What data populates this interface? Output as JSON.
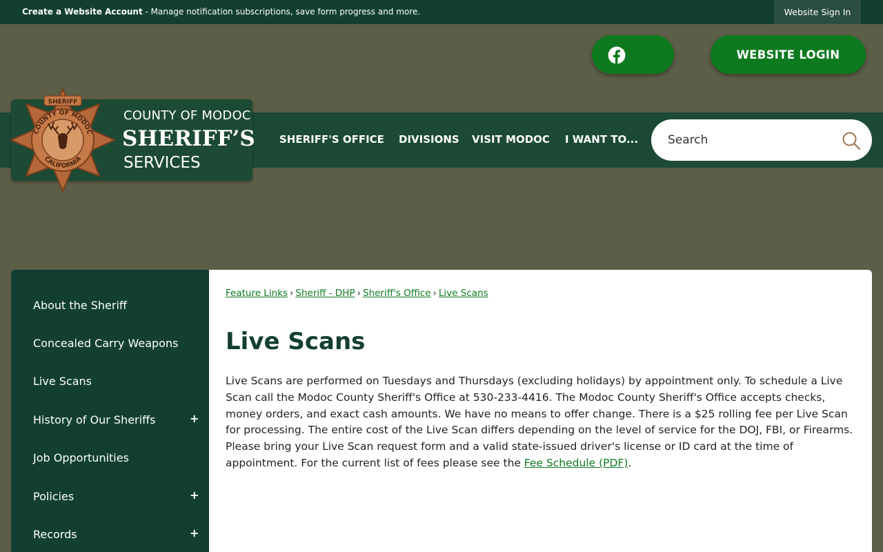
{
  "topbar": {
    "create_account": "Create a Website Account",
    "create_account_desc": " - Manage notification subscriptions, save form progress and more.",
    "sign_in": "Website Sign In"
  },
  "header": {
    "login_label": "WEBSITE LOGIN",
    "logo": {
      "line1": "COUNTY OF MODOC",
      "line2": "SHERIFF’S",
      "line3": "SERVICES",
      "badge_top": "SHERIFF",
      "badge_ring_top": "COUNTY OF MODOC",
      "badge_ring_bottom": "CALIFORNIA"
    },
    "nav": [
      "SHERIFF'S OFFICE",
      "DIVISIONS",
      "VISIT MODOC",
      "I WANT TO..."
    ],
    "search_placeholder": "Search"
  },
  "sidebar": {
    "items": [
      {
        "label": "About the Sheriff",
        "expandable": false
      },
      {
        "label": "Concealed Carry Weapons",
        "expandable": false
      },
      {
        "label": "Live Scans",
        "expandable": false
      },
      {
        "label": "History of Our Sheriffs",
        "expandable": true
      },
      {
        "label": "Job Opportunities",
        "expandable": false
      },
      {
        "label": "Policies",
        "expandable": true
      },
      {
        "label": "Records",
        "expandable": true
      }
    ],
    "expand_symbol": "+"
  },
  "main": {
    "breadcrumbs": [
      "Feature Links",
      "Sheriff - DHP",
      "Sheriff's Office",
      "Live Scans"
    ],
    "breadcrumb_sep": "›",
    "title": "Live Scans",
    "body": "Live Scans are performed on Tuesdays and Thursdays (excluding holidays) by appointment only. To schedule a Live Scan call the Modoc County Sheriff's Office at 530-233-4416. The Modoc County Sheriff's Office accepts checks, money orders, and exact cash amounts. We have no means to offer change. There is a $25 rolling fee per Live Scan for processing. The entire cost of the Live Scan differs depending on the level of service for the DOJ, FBI, or Firearms. Please bring your Live Scan request form and a valid state-issued driver's license or ID card at the time of appointment. For the current list of fees please see the ",
    "link": "Fee Schedule (PDF)",
    "body_end": "."
  },
  "colors": {
    "dark_green": "#123f31",
    "nav_green": "#1c4a35",
    "button_green": "#0d7a1f",
    "olive_bg": "#5d5e47",
    "badge_copper": "#b5683a"
  }
}
